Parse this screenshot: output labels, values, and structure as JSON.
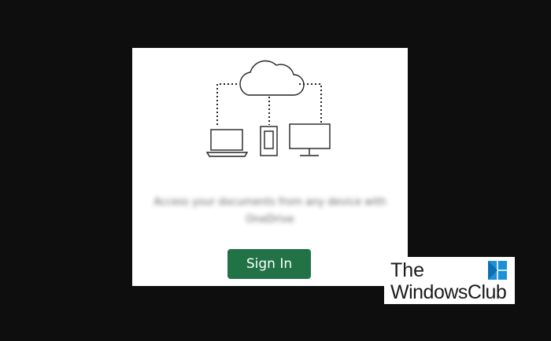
{
  "dialog": {
    "message": "Access your documents from any device with OneDrive",
    "sign_in_label": "Sign In",
    "button_color": "#217346"
  },
  "watermark": {
    "line1": "The",
    "line2": "WindowsClub",
    "logo_color": "#1e90d6"
  }
}
